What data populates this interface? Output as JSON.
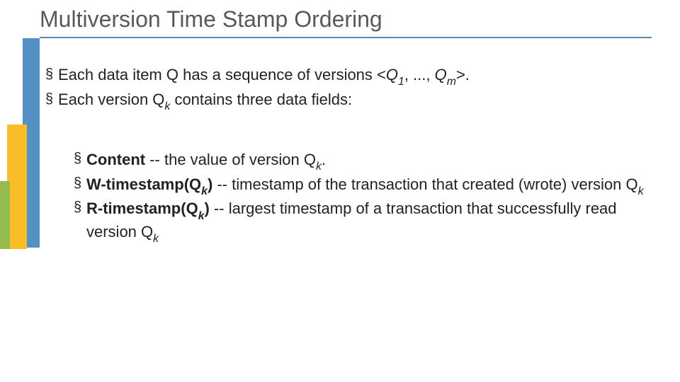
{
  "title": "Multiversion Time Stamp Ordering",
  "outer": {
    "l1_a": "Each data item Q has a sequence of versions <",
    "l1_q1": "Q",
    "l1_s1": "1",
    "l1_mid": ", ..., ",
    "l1_q2": "Q",
    "l1_s2": "m",
    "l1_b": ">.",
    "l2_a": "Each version Q",
    "l2_sk": "k",
    "l2_b": " contains three data fields:"
  },
  "inner": {
    "c_label": "Content",
    "c_a": " -- the value of version Q",
    "c_sk": "k",
    "c_b": ".",
    "w_label_a": "W-timestamp",
    "w_label_b": "(Q",
    "w_sk": "k",
    "w_label_c": ")",
    "w_a": " -- timestamp of the transaction that created (wrote) version Q",
    "w_sk2": "k",
    "r_label_a": "R-timestamp",
    "r_label_b": "(Q",
    "r_sk": "k",
    "r_label_c": ")",
    "r_a": " -- largest timestamp of a transaction that successfully read version Q",
    "r_sk2": "k"
  }
}
